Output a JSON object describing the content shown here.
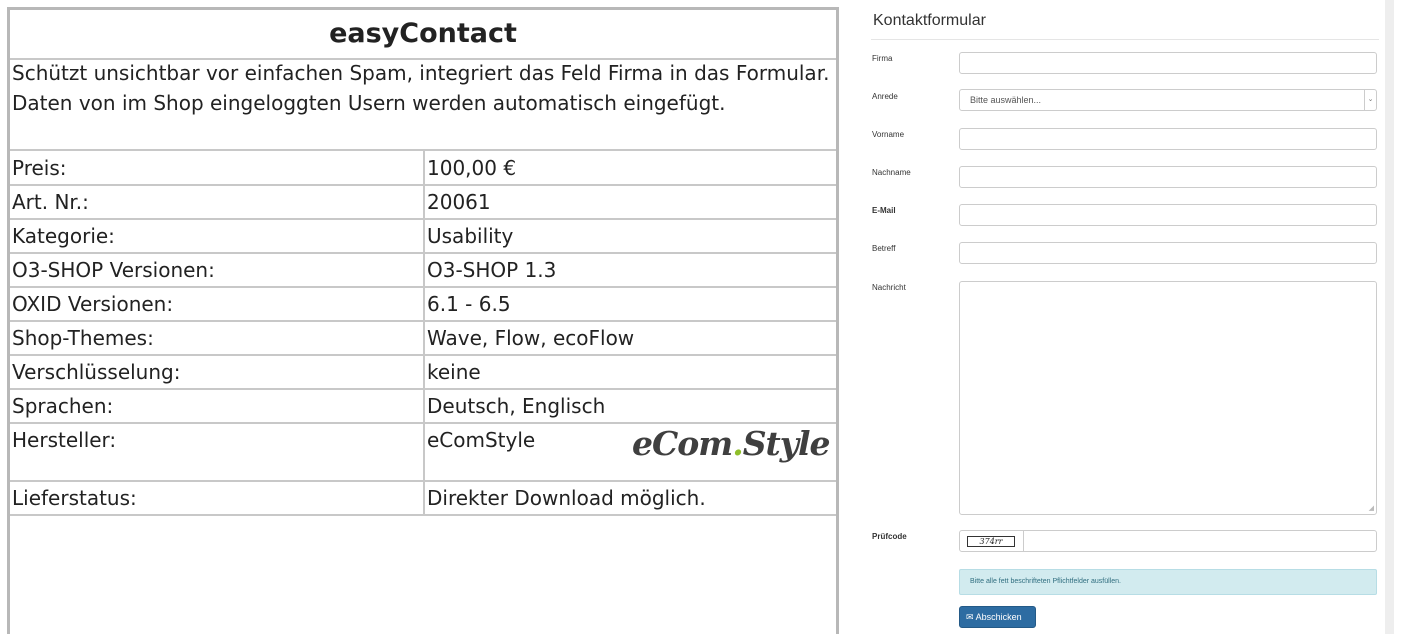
{
  "product": {
    "title": "easyContact",
    "description": "Schützt unsichtbar vor einfachen Spam, integriert das Feld Firma in das Formular. Daten von im Shop eingeloggten Usern werden automatisch eingefügt.",
    "rows": [
      {
        "label": "Preis:",
        "value": "100,00 €"
      },
      {
        "label": "Art. Nr.:",
        "value": "20061"
      },
      {
        "label": "Kategorie:",
        "value": "Usability"
      },
      {
        "label": "O3-SHOP Versionen:",
        "value": "O3-SHOP 1.3"
      },
      {
        "label": "OXID Versionen:",
        "value": "6.1 - 6.5"
      },
      {
        "label": "Shop-Themes:",
        "value": "Wave, Flow, ecoFlow"
      },
      {
        "label": "Verschlüsselung:",
        "value": "keine"
      },
      {
        "label": "Sprachen:",
        "value": "Deutsch, Englisch"
      },
      {
        "label": "Hersteller:",
        "value": "eComStyle"
      },
      {
        "label": "Lieferstatus:",
        "value": "Direkter Download möglich."
      }
    ],
    "logo": {
      "part1": "eCom",
      "dot": ".",
      "part2": "Style",
      "accent_color": "#8fbf2a"
    }
  },
  "form": {
    "title": "Kontaktformular",
    "labels": {
      "company": "Firma",
      "salutation": "Anrede",
      "firstname": "Vorname",
      "lastname": "Nachname",
      "email": "E-Mail",
      "subject": "Betreff",
      "message": "Nachricht",
      "captcha": "Prüfcode"
    },
    "salutation_selected": "Bitte auswählen...",
    "captcha_code": "374rr",
    "info": "Bitte alle fett beschrifteten Pflichtfelder ausfüllen.",
    "submit_label": "Abschicken",
    "submit_icon": "envelope-icon",
    "colors": {
      "button": "#2d6ca2",
      "info_bg": "#d2ebef"
    }
  }
}
